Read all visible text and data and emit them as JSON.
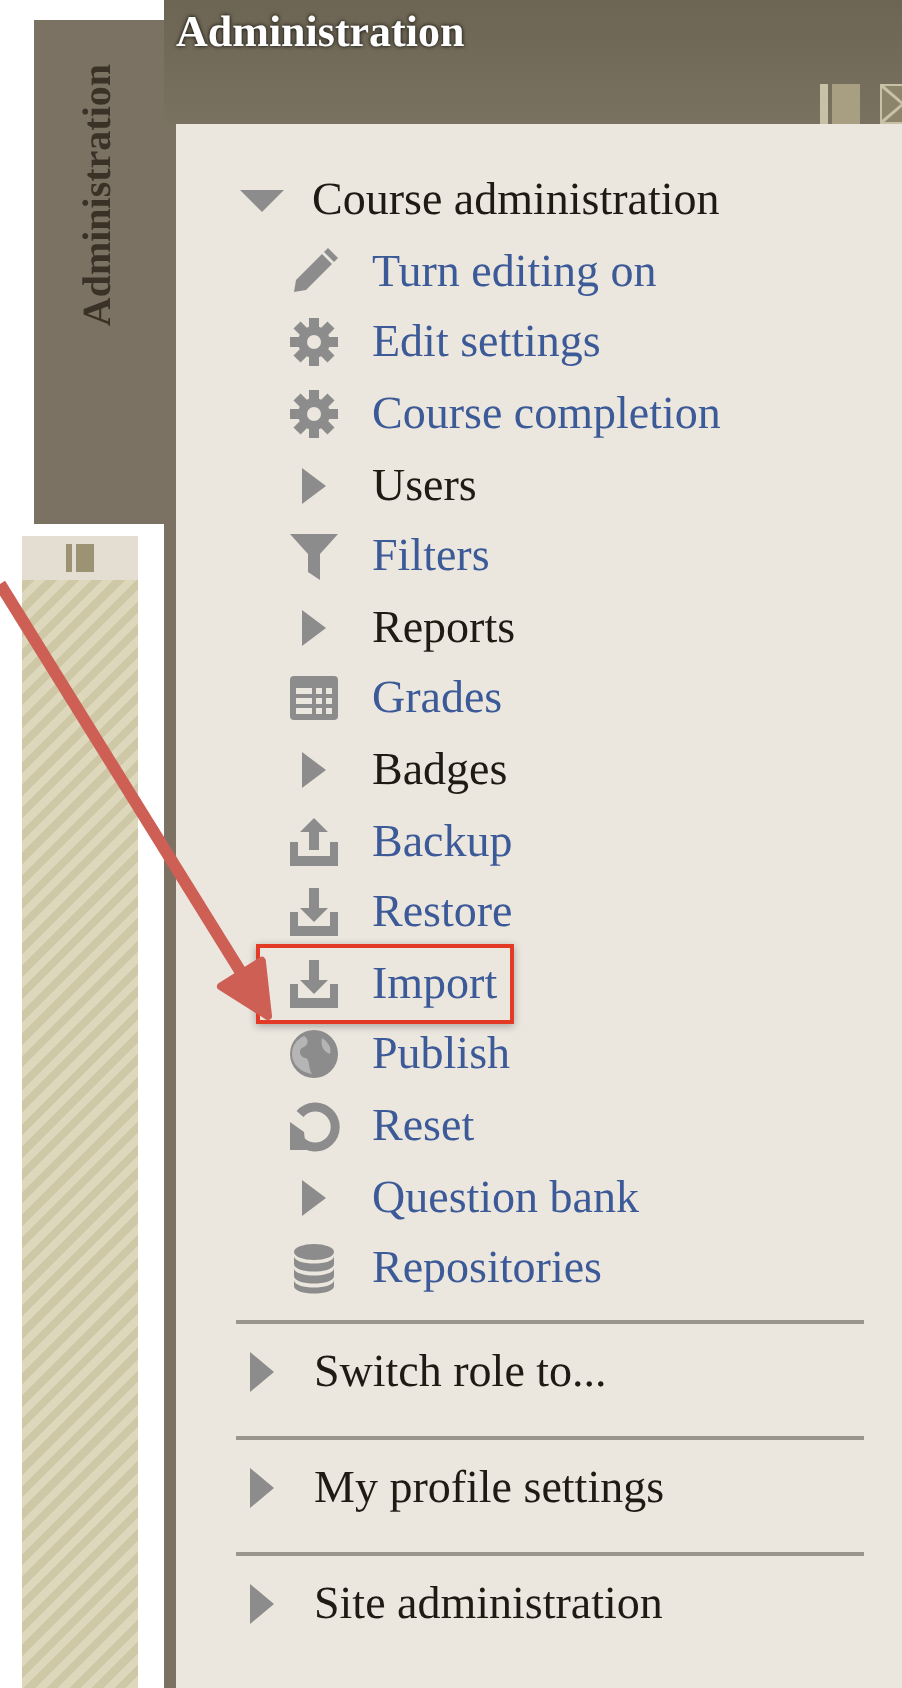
{
  "dock_tab": {
    "label": "Administration"
  },
  "block": {
    "title": "Administration",
    "tree": [
      {
        "label": "Course administration",
        "expanded": true,
        "children": [
          {
            "label": "Turn editing on",
            "kind": "pencil",
            "link": true,
            "highlighted": false
          },
          {
            "label": "Edit settings",
            "kind": "gear",
            "link": true,
            "highlighted": false
          },
          {
            "label": "Course completion",
            "kind": "gear",
            "link": true,
            "highlighted": false
          },
          {
            "label": "Users",
            "kind": "caret",
            "link": false,
            "highlighted": false
          },
          {
            "label": "Filters",
            "kind": "filter",
            "link": true,
            "highlighted": false
          },
          {
            "label": "Reports",
            "kind": "caret",
            "link": false,
            "highlighted": false
          },
          {
            "label": "Grades",
            "kind": "grid",
            "link": true,
            "highlighted": false
          },
          {
            "label": "Badges",
            "kind": "caret",
            "link": false,
            "highlighted": false
          },
          {
            "label": "Backup",
            "kind": "upload",
            "link": true,
            "highlighted": false
          },
          {
            "label": "Restore",
            "kind": "download",
            "link": true,
            "highlighted": false
          },
          {
            "label": "Import",
            "kind": "download",
            "link": true,
            "highlighted": true
          },
          {
            "label": "Publish",
            "kind": "globe",
            "link": true,
            "highlighted": false
          },
          {
            "label": "Reset",
            "kind": "reset",
            "link": true,
            "highlighted": false
          },
          {
            "label": "Question bank",
            "kind": "caret",
            "link": true,
            "highlighted": false
          },
          {
            "label": "Repositories",
            "kind": "database",
            "link": true,
            "highlighted": false
          }
        ]
      }
    ],
    "sections": [
      {
        "label": "Switch role to...",
        "expanded": false
      },
      {
        "label": "My profile settings",
        "expanded": false
      },
      {
        "label": "Site administration",
        "expanded": false
      }
    ]
  }
}
